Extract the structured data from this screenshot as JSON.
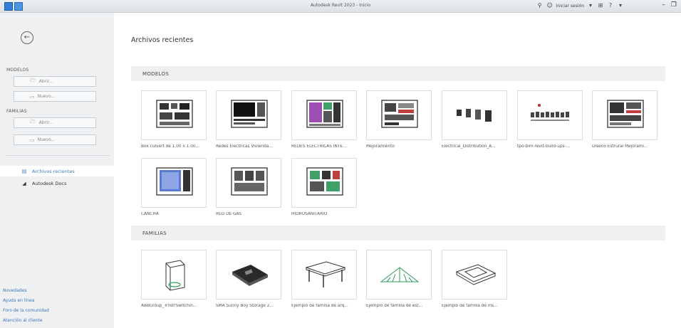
{
  "window": {
    "title": "Autodesk Revit 2023 - Inicio",
    "signin_label": "Iniciar sesión",
    "right_icons": [
      "binoculars-icon",
      "user-icon",
      "cart-icon",
      "help-icon"
    ]
  },
  "sidebar": {
    "modelos_label": "MODELOS",
    "modelos_open": "Abrir...",
    "modelos_new": "Nuevo...",
    "familias_label": "FAMILIAS",
    "familias_open": "Abrir...",
    "familias_new": "Nuevo...",
    "nav": [
      {
        "label": "Archivos recientes",
        "icon": "recent-files-icon",
        "active": true
      },
      {
        "label": "Autodesk Docs",
        "icon": "autodesk-logo-icon",
        "active": false
      }
    ],
    "links": [
      "Novedades",
      "Ayuda en línea",
      "Foro de la comunidad",
      "Atención al cliente"
    ]
  },
  "main": {
    "title": "Archivos recientes",
    "modelos_header": "MODELOS",
    "familias_header": "FAMILIAS",
    "models": [
      "Box culvert de 1.00 x 1.00...",
      "Redes Electricas Vivienda...",
      "REDES ELECTRICAS INTE...",
      "Mejoramiento",
      "Electrical_Distribution_A...",
      "tpo-bim-revit-build-ups-...",
      "Diseño Estrural Mejorami...",
      "CANCHA",
      "RED DE GAS",
      "HIDROSANITARIO"
    ],
    "families": [
      "ABBGroup_TrnsfrSwitchin...",
      "SMA Sunny Boy Storage 2...",
      "Ejemplo de familia de arq...",
      "Ejemplo de familia de est...",
      "Ejemplo de familia de ins..."
    ]
  },
  "colors": {
    "accent": "#3d78b8",
    "sidebar_bg": "#eef0f2",
    "section_bg": "#eef0f2"
  }
}
